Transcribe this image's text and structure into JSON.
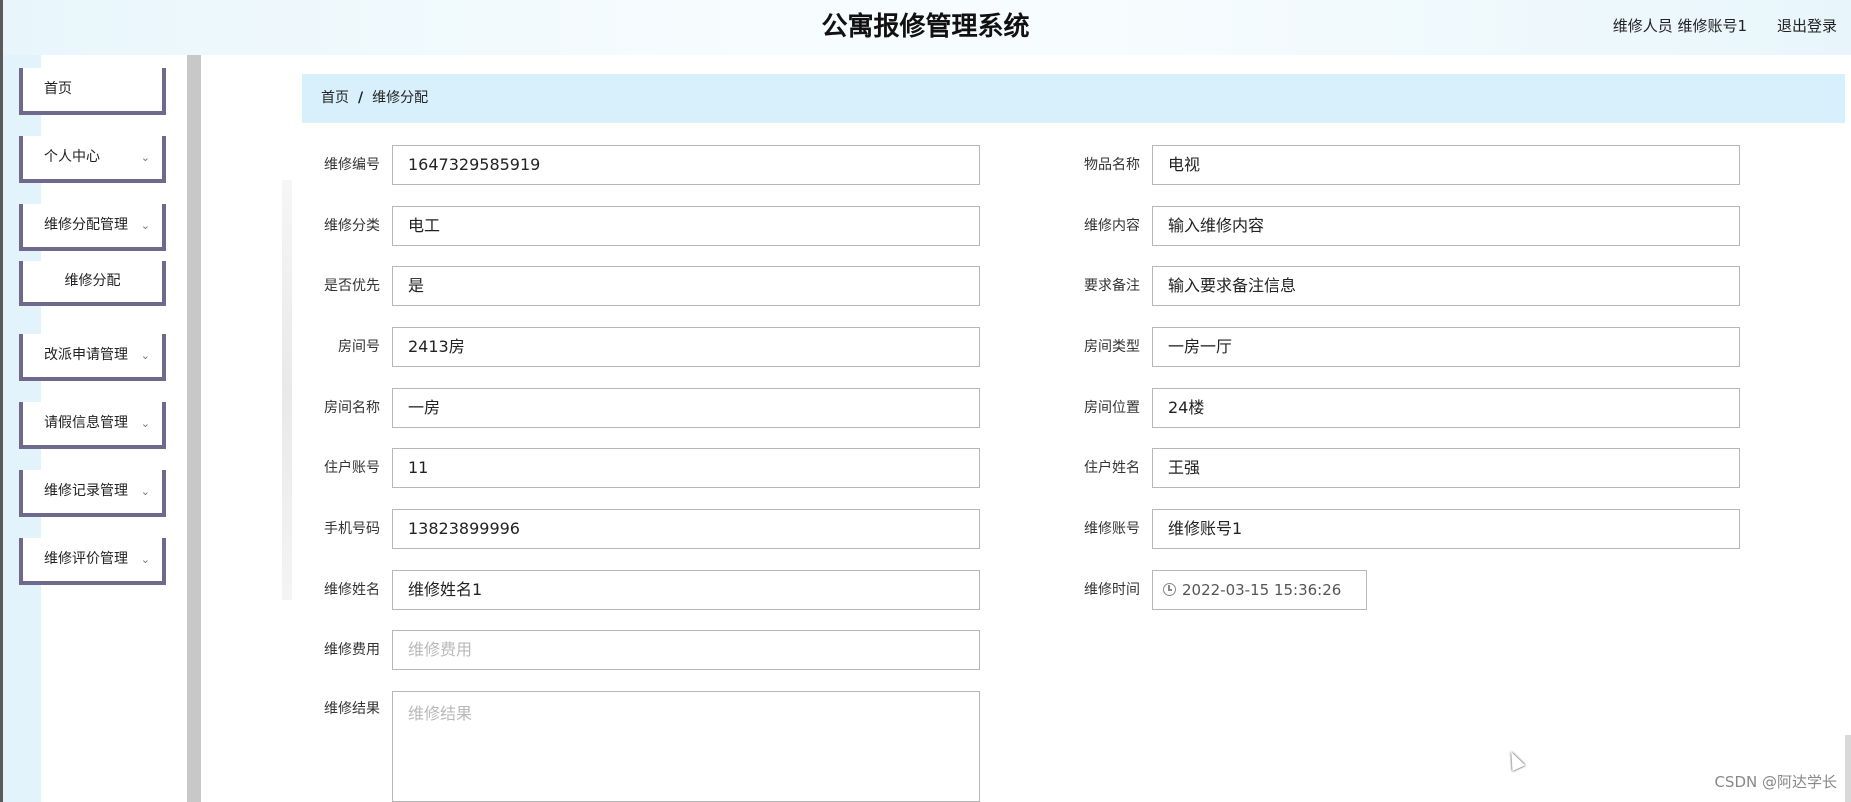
{
  "header": {
    "title": "公寓报修管理系统",
    "user_info": "维修人员 维修账号1",
    "logout": "退出登录"
  },
  "sidebar": {
    "items": [
      {
        "label": "首页",
        "has_chevron": false
      },
      {
        "label": "个人中心",
        "has_chevron": true
      },
      {
        "label": "维修分配管理",
        "has_chevron": true
      },
      {
        "label": "维修分配",
        "has_chevron": false,
        "sub": true
      },
      {
        "label": "改派申请管理",
        "has_chevron": true
      },
      {
        "label": "请假信息管理",
        "has_chevron": true
      },
      {
        "label": "维修记录管理",
        "has_chevron": true
      },
      {
        "label": "维修评价管理",
        "has_chevron": true
      }
    ],
    "chevron_icon": "chevron-down-icon"
  },
  "breadcrumb": {
    "home": "首页",
    "separator": "/",
    "current": "维修分配"
  },
  "form": {
    "left": [
      {
        "label": "维修编号",
        "value": "1647329585919"
      },
      {
        "label": "维修分类",
        "value": "电工"
      },
      {
        "label": "是否优先",
        "value": "是"
      },
      {
        "label": "房间号",
        "value": "2413房"
      },
      {
        "label": "房间名称",
        "value": "一房"
      },
      {
        "label": "住户账号",
        "value": "11"
      },
      {
        "label": "手机号码",
        "value": "13823899996"
      },
      {
        "label": "维修姓名",
        "value": "维修姓名1"
      },
      {
        "label": "维修费用",
        "placeholder": "维修费用"
      },
      {
        "label": "维修结果",
        "placeholder": "维修结果"
      }
    ],
    "right": [
      {
        "label": "物品名称",
        "value": "电视"
      },
      {
        "label": "维修内容",
        "value": "输入维修内容"
      },
      {
        "label": "要求备注",
        "value": "输入要求备注信息"
      },
      {
        "label": "房间类型",
        "value": "一房一厅"
      },
      {
        "label": "房间位置",
        "value": "24楼"
      },
      {
        "label": "住户姓名",
        "value": "王强"
      },
      {
        "label": "维修账号",
        "value": "维修账号1"
      },
      {
        "label": "维修时间",
        "value": "2022-03-15 15:36:26"
      }
    ]
  },
  "watermark": "CSDN @阿达学长"
}
